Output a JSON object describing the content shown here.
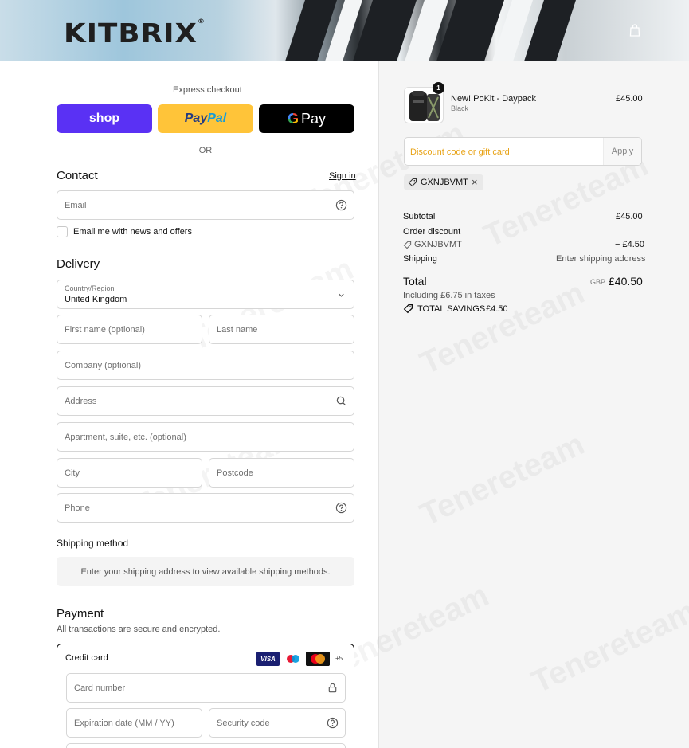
{
  "header": {
    "logo_text": "KITBRIX",
    "cart_icon": "shopping-bag-icon"
  },
  "express": {
    "title": "Express checkout",
    "shop_label": "shop",
    "paypal_label_pay": "Pay",
    "paypal_label_pal": "Pal",
    "gpay_g": "G",
    "gpay_label": "Pay",
    "or_label": "OR"
  },
  "contact": {
    "title": "Contact",
    "sign_in": "Sign in",
    "email_placeholder": "Email",
    "newsletter_label": "Email me with news and offers",
    "help_icon": "question-circle-icon"
  },
  "delivery": {
    "title": "Delivery",
    "country_label": "Country/Region",
    "country_value": "United Kingdom",
    "first_name": "First name (optional)",
    "last_name": "Last name",
    "company": "Company (optional)",
    "address": "Address",
    "apartment": "Apartment, suite, etc. (optional)",
    "city": "City",
    "postcode": "Postcode",
    "phone": "Phone"
  },
  "shipping_method": {
    "title": "Shipping method",
    "message": "Enter your shipping address to view available shipping methods."
  },
  "payment": {
    "title": "Payment",
    "subtitle": "All transactions are secure and encrypted.",
    "credit_card_label": "Credit card",
    "visa_label": "VISA",
    "more_cards": "+5",
    "card_number": "Card number",
    "expiration": "Expiration date (MM / YY)",
    "security_code": "Security code"
  },
  "summary": {
    "item": {
      "quantity": "1",
      "name": "New! PoKit - Daypack",
      "variant": "Black",
      "price": "£45.00"
    },
    "discount_placeholder": "Discount code or gift card",
    "apply_label": "Apply",
    "applied_code": "GXNJBVMT",
    "subtotal_label": "Subtotal",
    "subtotal_value": "£45.00",
    "order_discount_label": "Order discount",
    "discount_code": "GXNJBVMT",
    "discount_value": "− £4.50",
    "shipping_label": "Shipping",
    "shipping_value": "Enter shipping address",
    "total_label": "Total",
    "currency": "GBP",
    "total_value": "£40.50",
    "taxes_note": "Including £6.75 in taxes",
    "savings_label": "TOTAL SAVINGS",
    "savings_value": "£4.50"
  }
}
